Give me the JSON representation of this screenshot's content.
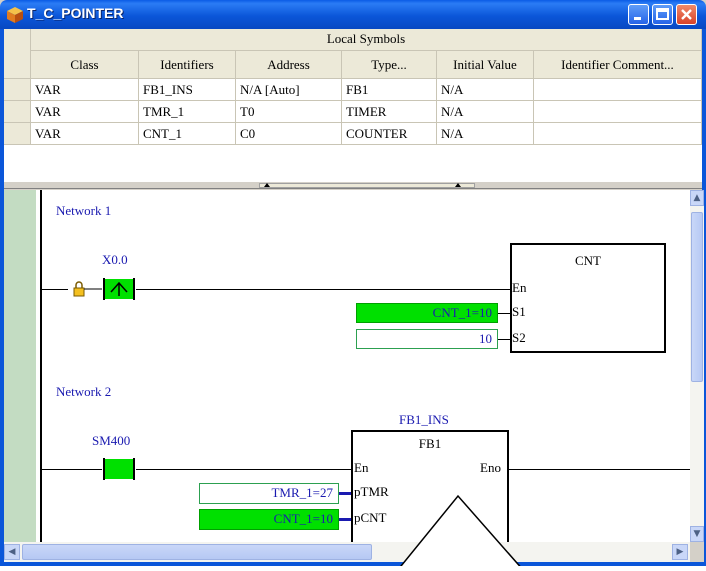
{
  "window": {
    "title": "T_C_POINTER"
  },
  "symbols": {
    "section_title": "Local Symbols",
    "columns": [
      "Class",
      "Identifiers",
      "Address",
      "Type...",
      "Initial Value",
      "Identifier Comment..."
    ],
    "rows": [
      [
        "VAR",
        "FB1_INS",
        "N/A [Auto]",
        "FB1",
        "N/A",
        ""
      ],
      [
        "VAR",
        "TMR_1",
        "T0",
        "TIMER",
        "N/A",
        ""
      ],
      [
        "VAR",
        "CNT_1",
        "C0",
        "COUNTER",
        "N/A",
        ""
      ]
    ]
  },
  "ladder": {
    "network1": {
      "label": "Network 1",
      "contact": "X0.0",
      "block_name": "CNT",
      "pins": [
        "En",
        "S1",
        "S2"
      ],
      "s1_value": "CNT_1=10",
      "s2_value": "10"
    },
    "network2": {
      "label": "Network 2",
      "contact": "SM400",
      "instance": "FB1_INS",
      "block_name": "FB1",
      "pin_en": "En",
      "pin_eno": "Eno",
      "pin_ptmr": "pTMR",
      "pin_pcnt": "pCNT",
      "ptmr_value": "TMR_1=27",
      "pcnt_value": "CNT_1=10"
    }
  },
  "colors": {
    "title_bar": "#0b56d9",
    "active_field": "#00e000",
    "gutter": "#c3dcc2",
    "label_text": "#1a1ab0"
  }
}
